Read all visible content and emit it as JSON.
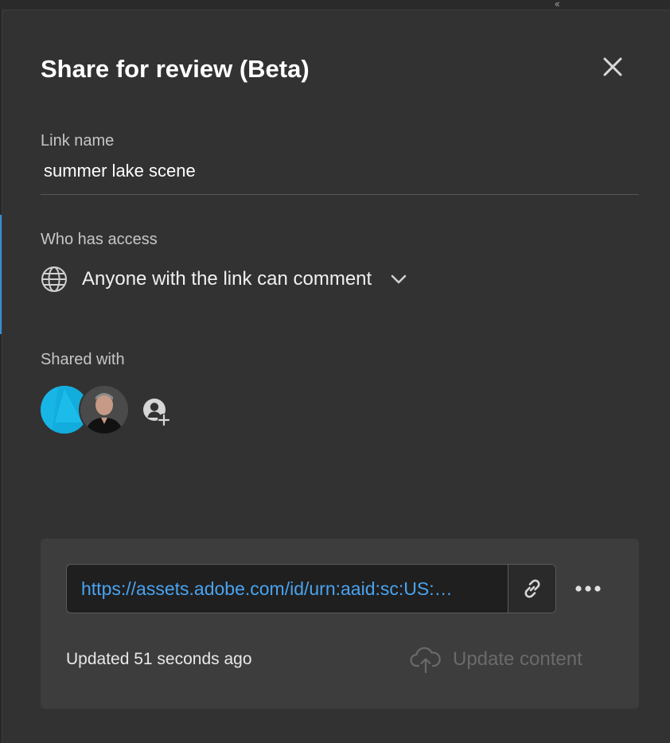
{
  "dialog": {
    "title": "Share for review (Beta)",
    "close_icon": "close-icon"
  },
  "link_name": {
    "label": "Link name",
    "value": "summer lake scene"
  },
  "access": {
    "label": "Who has access",
    "value": "Anyone with the link can comment",
    "icon": "globe-icon"
  },
  "shared_with": {
    "label": "Shared with",
    "avatars": [
      "avatar-cyan",
      "avatar-photo"
    ],
    "add_icon": "add-person-icon"
  },
  "link_panel": {
    "url": "https://assets.adobe.com/id/urn:aaid:sc:US:…",
    "copy_icon": "link-icon",
    "more_icon": "more-icon",
    "updated": "Updated 51 seconds ago",
    "update_button": "Update content",
    "update_icon": "cloud-upload-icon"
  },
  "colors": {
    "dialog_bg": "#323232",
    "panel_bg": "#3d3d3d",
    "link": "#4aa3f0",
    "avatar_accent": "#18b6e6",
    "disabled": "#6a6a6a"
  }
}
